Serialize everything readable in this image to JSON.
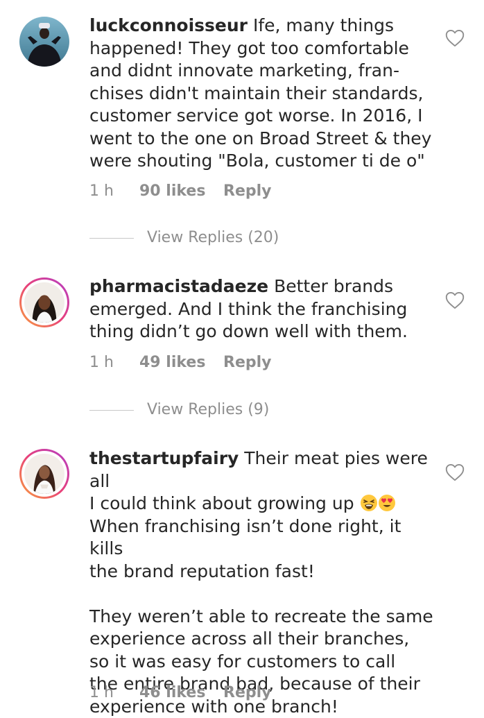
{
  "comments": [
    {
      "username": "luckconnoisseur",
      "text": "Ife, many things happened! They got too comfortable and didnt innovate marketing, fran-chises didn't maintain their standards, customer service got worse. In 2016, I went to the one on Broad Street & they were shouting \"Bola, customer ti de o\"",
      "lines": [
        "Ife, many things",
        "happened! They got too comfortable",
        "and didnt innovate marketing, fran-",
        "chises didn't maintain their standards,",
        "customer service got worse. In 2016, I",
        "went to the one on Broad Street & they",
        "were shouting \"Bola, customer ti de o\""
      ],
      "time": "1 h",
      "likes": "90 likes",
      "reply_label": "Reply",
      "view_replies": "View Replies (20)",
      "avatar_icon": "user-avatar-photo",
      "story_ring": false
    },
    {
      "username": "pharmacistadaeze",
      "lines": [
        "Better brands",
        "emerged. And I think the franchising",
        "thing didn’t go down well with them."
      ],
      "time": "1 h",
      "likes": "49 likes",
      "reply_label": "Reply",
      "view_replies": "View Replies (9)",
      "avatar_icon": "user-avatar-photo",
      "story_ring": true
    },
    {
      "username": "thestartupfairy",
      "lines": [
        "Their meat pies were all",
        "I could think about growing up",
        "When franchising isn’t done right, it kills",
        "the brand reputation fast!",
        "",
        "They weren’t able to recreate the same",
        "experience across all their branches,",
        "so it was easy for customers to call",
        "the entire brand bad, because of their",
        "experience with one branch!"
      ],
      "emojis": [
        "tired-face-emoji",
        "heart-eyes-emoji"
      ],
      "time": "1 h",
      "likes": "46 likes",
      "reply_label": "Reply",
      "avatar_icon": "user-avatar-photo",
      "story_ring": true
    }
  ],
  "colors": {
    "text": "#262626",
    "secondary": "#8e8e8e",
    "ring_start": "#f9a23c",
    "ring_end": "#b23ec8"
  },
  "icons": {
    "like": "heart-outline-icon"
  }
}
